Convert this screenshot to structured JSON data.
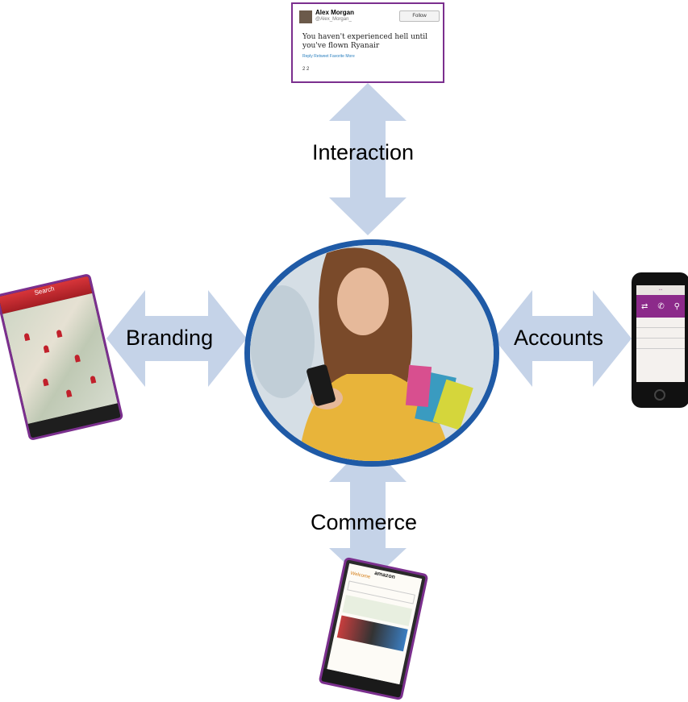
{
  "labels": {
    "interaction": "Interaction",
    "branding": "Branding",
    "accounts": "Accounts",
    "commerce": "Commerce"
  },
  "tweet": {
    "name": "Alex Morgan",
    "handle": "@Alex_Morgan_",
    "follow": "Follow",
    "text": "You haven't experienced hell until you've flown Ryanair",
    "actions": "Reply   Retweet   Favorite   More",
    "stats": "2        2"
  },
  "branding_phone": {
    "title": "Search"
  },
  "commerce_phone": {
    "logo": "amazon",
    "section": "Welcome"
  },
  "colors": {
    "arrow": "#c5d3e8",
    "circle_border": "#1f5aa6",
    "frame": "#7b2f8e",
    "accent": "#8c2a8a"
  }
}
